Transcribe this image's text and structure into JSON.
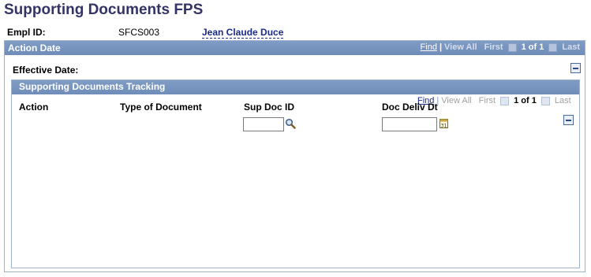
{
  "page": {
    "title": "Supporting Documents FPS"
  },
  "employee": {
    "empl_id_label": "Empl ID:",
    "empl_id_value": "SFCS003",
    "name": "Jean Claude Duce"
  },
  "action_date": {
    "header": "Action Date",
    "nav": {
      "find": "Find",
      "view_all": "View All",
      "first": "First",
      "position": "1 of 1",
      "last": "Last"
    },
    "effective_date_label": "Effective Date:"
  },
  "tracking": {
    "header": "Supporting Documents Tracking",
    "nav": {
      "find": "Find",
      "view_all": "View All",
      "first": "First",
      "position": "1 of 1",
      "last": "Last"
    },
    "columns": [
      "Action",
      "Type of Document",
      "Sup Doc ID",
      "Doc Deliv Dt"
    ],
    "sup_doc_id_value": "",
    "doc_deliv_dt_value": ""
  },
  "icons": {
    "lookup": "magnifier-icon",
    "calendar": "calendar-icon",
    "collapse": "minus-icon",
    "prev": "arrow-left-icon",
    "next": "arrow-right-icon"
  },
  "colors": {
    "title": "#333366",
    "bar": "#7f9cc4",
    "link": "#1a2a8a"
  }
}
